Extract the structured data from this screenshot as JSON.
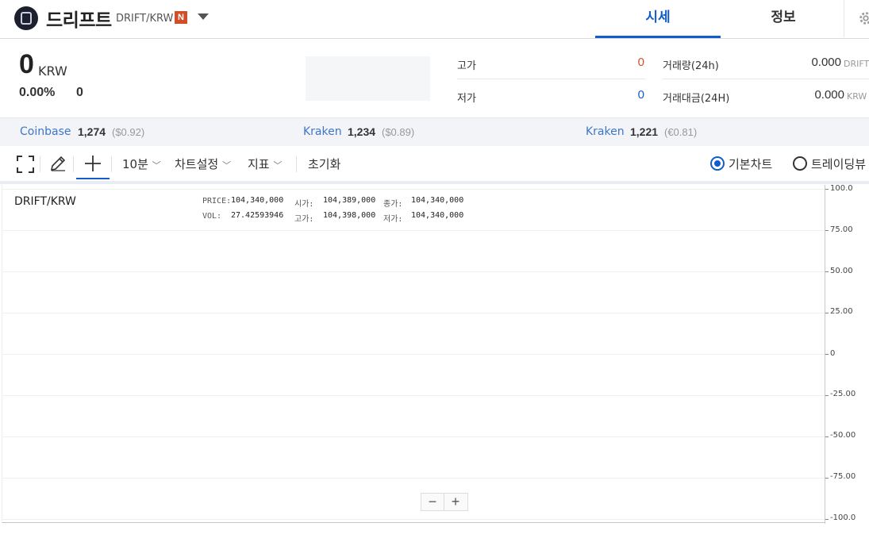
{
  "header": {
    "coin_name": "드리프트",
    "pair": "DRIFT/KRW",
    "badge": "N",
    "tabs": [
      {
        "label": "시세",
        "active": true
      },
      {
        "label": "정보",
        "active": false
      }
    ]
  },
  "summary": {
    "price": "0",
    "price_unit": "KRW",
    "change_pct": "0.00%",
    "change_amount": "0",
    "high_label": "고가",
    "high_value": "0",
    "low_label": "저가",
    "low_value": "0",
    "volume_label": "거래량(24h)",
    "volume_value": "0.000",
    "volume_unit": "DRIFT",
    "amount_label": "거래대금(24H)",
    "amount_value": "0.000",
    "amount_unit": "KRW"
  },
  "exchanges": [
    {
      "name": "Coinbase",
      "price": "1,274",
      "fx": "($0.92)"
    },
    {
      "name": "Kraken",
      "price": "1,234",
      "fx": "($0.89)"
    },
    {
      "name": "Kraken",
      "price": "1,221",
      "fx": "(€0.81)"
    }
  ],
  "toolbar": {
    "interval": "10분",
    "chart_settings": "차트설정",
    "indicators": "지표",
    "reset": "초기화",
    "chart_basic": "기본차트",
    "chart_tradingview": "트레이딩뷰"
  },
  "chart": {
    "pair": "DRIFT/KRW",
    "price_label": "PRICE:",
    "price_value": "104,340,000",
    "open_label": "시가:",
    "open_value": "104,389,000",
    "close_label": "종가:",
    "close_value": "104,340,000",
    "vol_label": "VOL:",
    "vol_value": "27.42593946",
    "high_label": "고가:",
    "high_value": "104,398,000",
    "low_label": "저가:",
    "low_value": "104,340,000",
    "yticks": [
      "100.0",
      "75.00",
      "50.00",
      "25.00",
      "0",
      "-25.00",
      "-50.00",
      "-75.00",
      "-100.0"
    ],
    "zoom_out": "−",
    "zoom_in": "+"
  },
  "colors": {
    "accent": "#115dcb",
    "high": "#d24f2a",
    "low": "#115dcb",
    "exchange_link": "#3f76c9"
  }
}
